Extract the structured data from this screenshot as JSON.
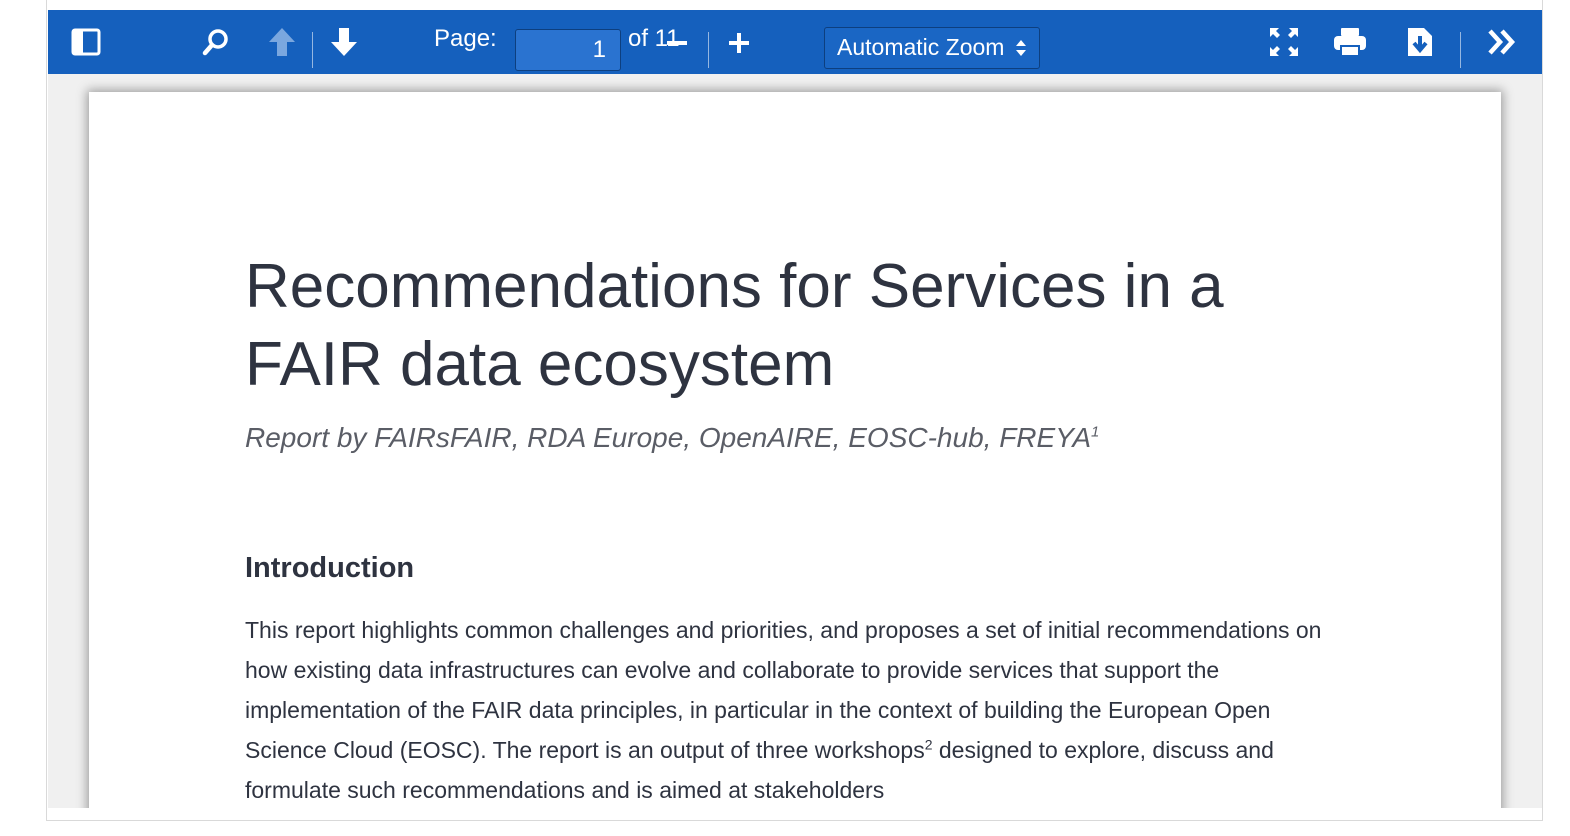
{
  "toolbar": {
    "sidebar_toggle_icon": "sidebar-toggle-icon",
    "search_icon": "search-icon",
    "prev_page_icon": "arrow-up-icon",
    "next_page_icon": "arrow-down-icon",
    "page_label": "Page:",
    "page_value": "1",
    "page_count": "of 11",
    "zoom_out_icon": "minus-icon",
    "zoom_in_icon": "plus-icon",
    "zoom_selected": "Automatic Zoom",
    "presentation_icon": "fullscreen-icon",
    "print_icon": "printer-icon",
    "download_icon": "download-icon",
    "tools_icon": "double-chevron-right-icon",
    "background_color": "#1560bd"
  },
  "document": {
    "title": "Recommendations for Services in a FAIR data ecosystem",
    "subtitle": "Report by FAIRsFAIR, RDA Europe, OpenAIRE, EOSC-hub, FREYA",
    "subtitle_footnote": "1",
    "section_heading": "Introduction",
    "body_part1": "This report highlights common challenges and priorities, and proposes a set of initial recommendations on how existing data infrastructures can evolve and collaborate to provide services that support the implementation of the FAIR data principles, in particular in the context of building the European Open Science Cloud (EOSC). The report is an output of three workshops",
    "body_footnote": "2",
    "body_part2": " designed to explore, discuss and formulate such recommendations and is aimed at stakeholders"
  }
}
